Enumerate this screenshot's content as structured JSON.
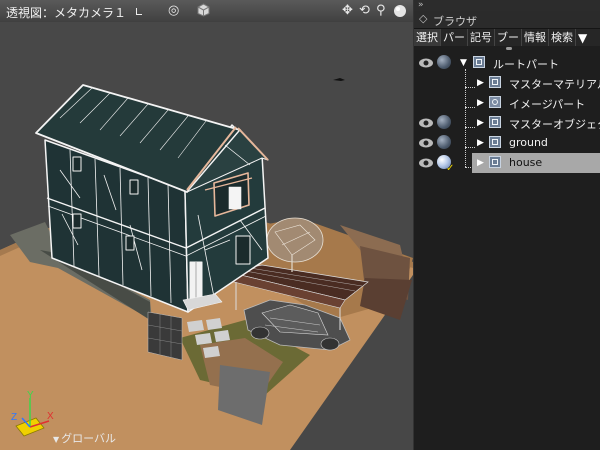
{
  "viewport": {
    "title": "透視図：メタカメラ１",
    "title_dropdown_icon": "corner-dropdown-icon",
    "toolbar_icons": [
      "target-icon",
      "cube-icon",
      "move-icon",
      "rotate-icon",
      "zoom-icon",
      "sphere-icon"
    ],
    "axis_gizmo": {
      "x": "X",
      "y": "Y",
      "z": "Z"
    },
    "coordinate_mode": "グローバル"
  },
  "browser": {
    "header": "ブラウザ",
    "tabs": [
      {
        "label": "選択",
        "active": true
      },
      {
        "label": "パー",
        "active": false
      },
      {
        "label": "記号",
        "active": false
      },
      {
        "label": "ブー",
        "active": false
      },
      {
        "label": "情報",
        "active": false
      },
      {
        "label": "検索",
        "active": false
      }
    ],
    "tree": [
      {
        "label": "ルートパート",
        "depth": 0,
        "expanded": true,
        "eye": true,
        "ball": "normal",
        "selected": false,
        "icon": "part-icon"
      },
      {
        "label": "マスターマテリアル",
        "depth": 1,
        "expanded": false,
        "eye": false,
        "ball": "none",
        "selected": false,
        "icon": "part-icon"
      },
      {
        "label": "イメージパート",
        "depth": 1,
        "expanded": false,
        "eye": false,
        "ball": "none",
        "selected": false,
        "icon": "image-part-icon"
      },
      {
        "label": "マスターオブジェクト",
        "depth": 1,
        "expanded": false,
        "eye": true,
        "ball": "normal",
        "selected": false,
        "icon": "part-icon"
      },
      {
        "label": "ground",
        "depth": 1,
        "expanded": false,
        "eye": true,
        "ball": "normal",
        "selected": false,
        "icon": "part-icon"
      },
      {
        "label": "house",
        "depth": 1,
        "expanded": false,
        "eye": true,
        "ball": "bright",
        "selected": true,
        "icon": "part-icon"
      }
    ]
  }
}
